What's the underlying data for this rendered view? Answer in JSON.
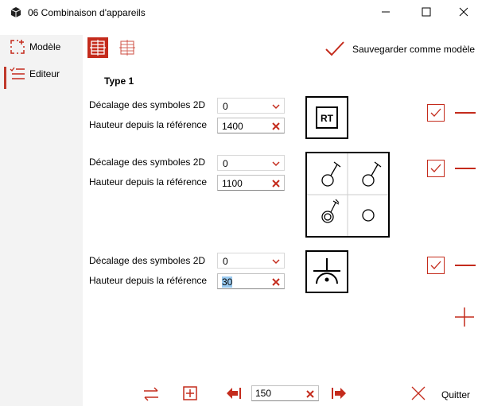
{
  "window": {
    "title": "06 Combinaison d'appareils",
    "minimize": "—",
    "maximize": "☐",
    "close": "✕"
  },
  "sidebar": {
    "items": [
      {
        "label": "Modèle",
        "icon": "dashed-add-icon",
        "active": false
      },
      {
        "label": "Editeur",
        "icon": "list-edit-icon",
        "active": true
      }
    ]
  },
  "toolbar": {
    "save_label": "Sauvegarder comme modèle",
    "accent": "#c42b1c"
  },
  "content": {
    "type_title": "Type 1",
    "rows": [
      {
        "offset_label": "Décalage des symboles 2D",
        "offset_value": "0",
        "height_label": "Hauteur depuis la référence",
        "height_value": "1400",
        "symbol": "RT",
        "checked": true
      },
      {
        "offset_label": "Décalage des symboles 2D",
        "offset_value": "0",
        "height_label": "Hauteur depuis la référence",
        "height_value": "1100",
        "symbol": "switch-grid",
        "checked": true
      },
      {
        "offset_label": "Décalage des symboles 2D",
        "offset_value": "0",
        "height_label": "Hauteur depuis la référence",
        "height_value": "30",
        "symbol": "socket",
        "checked": true
      }
    ]
  },
  "bottom": {
    "page_value": "150",
    "quit_label": "Quitter"
  }
}
